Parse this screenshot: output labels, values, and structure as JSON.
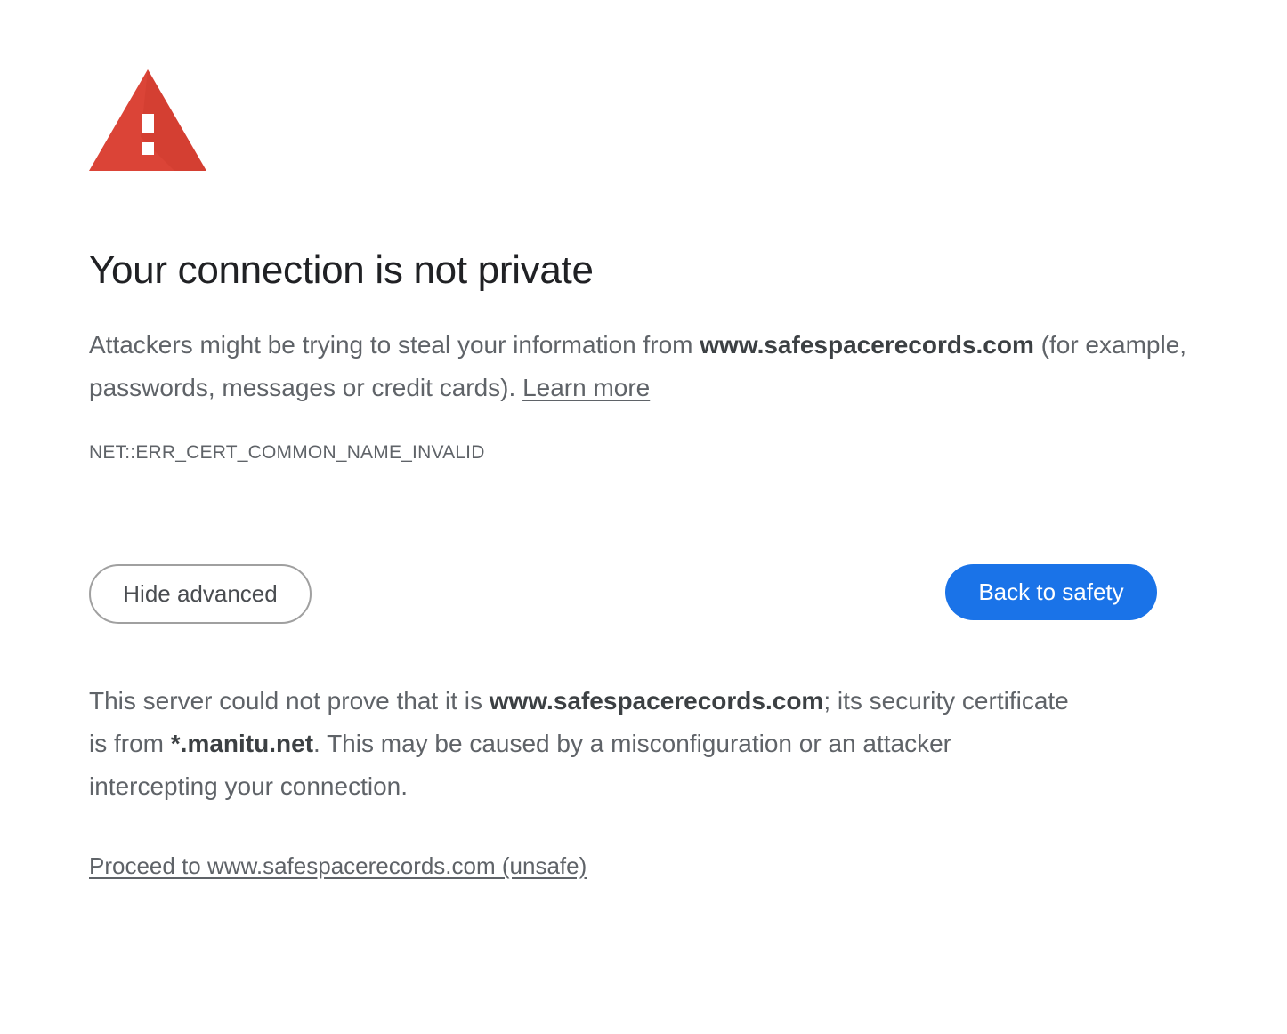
{
  "icon": {
    "name": "warning-triangle-icon",
    "color": "#db4437",
    "mark_color": "#ffffff"
  },
  "page_title": "Your connection is not private",
  "explanation": {
    "prefix": "Attackers might be trying to steal your information from ",
    "domain": "www.safespacerecords.com",
    "suffix": " (for example, passwords, messages or credit cards). ",
    "learn_more": "Learn more"
  },
  "error_code": "NET::ERR_CERT_COMMON_NAME_INVALID",
  "buttons": {
    "hide_advanced": "Hide advanced",
    "back_to_safety": "Back to safety"
  },
  "details": {
    "part1": "This server could not prove that it is ",
    "domain": "www.safespacerecords.com",
    "part2": "; its security certificate is from ",
    "cert_domain": "*.manitu.net",
    "part3": ". This may be caused by a misconfiguration or an attacker intercepting your connection."
  },
  "proceed_link": "Proceed to www.safespacerecords.com (unsafe)",
  "colors": {
    "primary_button": "#1a73e8",
    "title_text": "#202124",
    "body_text": "#5f6368"
  }
}
